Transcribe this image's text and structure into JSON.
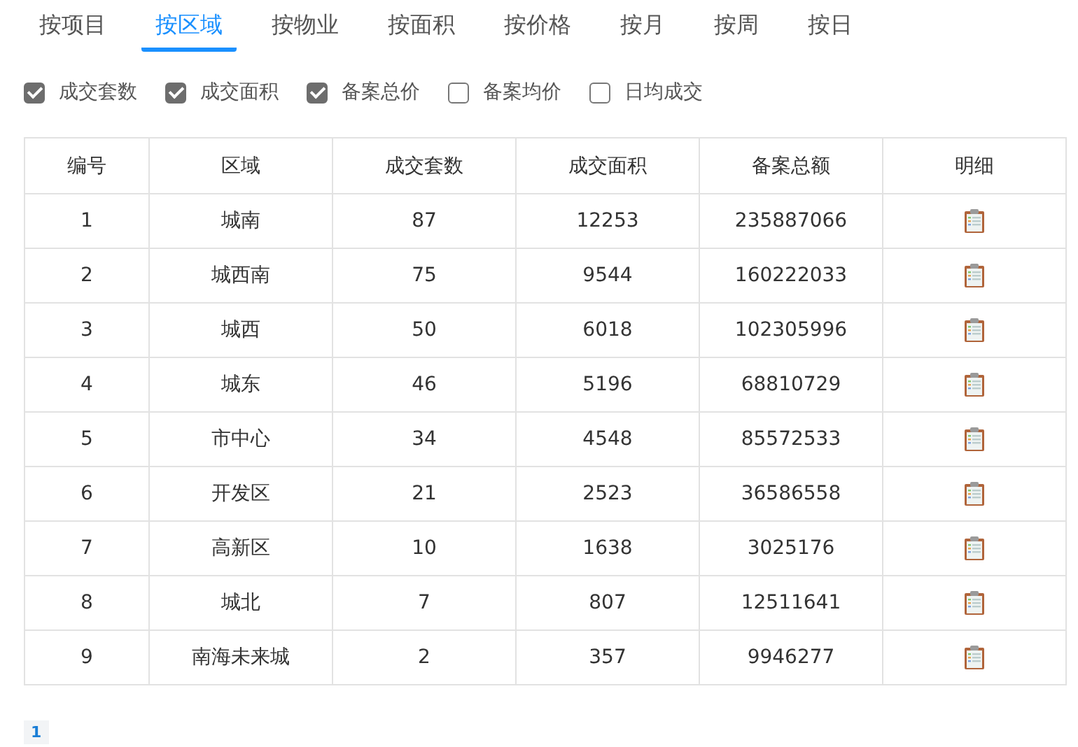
{
  "tabs": [
    {
      "label": "按项目",
      "selected": false
    },
    {
      "label": "按区域",
      "selected": true
    },
    {
      "label": "按物业",
      "selected": false
    },
    {
      "label": "按面积",
      "selected": false
    },
    {
      "label": "按价格",
      "selected": false
    },
    {
      "label": "按月",
      "selected": false
    },
    {
      "label": "按周",
      "selected": false
    },
    {
      "label": "按日",
      "selected": false
    }
  ],
  "filters": [
    {
      "label": "成交套数",
      "checked": true
    },
    {
      "label": "成交面积",
      "checked": true
    },
    {
      "label": "备案总价",
      "checked": true
    },
    {
      "label": "备案均价",
      "checked": false
    },
    {
      "label": "日均成交",
      "checked": false
    }
  ],
  "table": {
    "columns": [
      "编号",
      "区域",
      "成交套数",
      "成交面积",
      "备案总额",
      "明细"
    ],
    "rows": [
      [
        "1",
        "城南",
        "87",
        "12253",
        "235887066"
      ],
      [
        "2",
        "城西南",
        "75",
        "9544",
        "160222033"
      ],
      [
        "3",
        "城西",
        "50",
        "6018",
        "102305996"
      ],
      [
        "4",
        "城东",
        "46",
        "5196",
        "68810729"
      ],
      [
        "5",
        "市中心",
        "34",
        "4548",
        "85572533"
      ],
      [
        "6",
        "开发区",
        "21",
        "2523",
        "36586558"
      ],
      [
        "7",
        "高新区",
        "10",
        "1638",
        "3025176"
      ],
      [
        "8",
        "城北",
        "7",
        "807",
        "12511641"
      ],
      [
        "9",
        "南海未来城",
        "2",
        "357",
        "9946277"
      ]
    ]
  },
  "pagination": [
    {
      "label": "1",
      "selected": true
    }
  ]
}
